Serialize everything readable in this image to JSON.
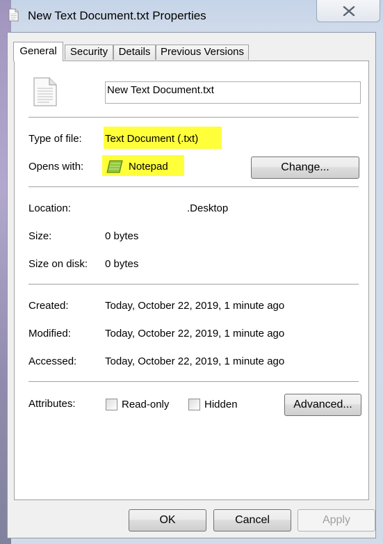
{
  "window": {
    "title": "New Text Document.txt Properties",
    "close_glyph": "✕"
  },
  "tabs": [
    {
      "label": "General",
      "active": true
    },
    {
      "label": "Security",
      "active": false
    },
    {
      "label": "Details",
      "active": false
    },
    {
      "label": "Previous Versions",
      "active": false
    }
  ],
  "general": {
    "file_name": "New Text Document.txt",
    "file_icon": "text-document-icon",
    "type_label": "Type of file:",
    "type_value": "Text Document (.txt)",
    "opens_label": "Opens with:",
    "opens_value": "Notepad",
    "opens_icon": "notepad-icon",
    "change_button": "Change...",
    "location_label": "Location:",
    "location_value": ".Desktop",
    "size_label": "Size:",
    "size_value": "0 bytes",
    "size_on_disk_label": "Size on disk:",
    "size_on_disk_value": "0 bytes",
    "created_label": "Created:",
    "created_value": "Today, October 22, 2019, 1 minute ago",
    "modified_label": "Modified:",
    "modified_value": "Today, October 22, 2019, 1 minute ago",
    "accessed_label": "Accessed:",
    "accessed_value": "Today, October 22, 2019, 1 minute ago",
    "attributes_label": "Attributes:",
    "readonly_label": "Read-only",
    "readonly_checked": false,
    "hidden_label": "Hidden",
    "hidden_checked": false,
    "advanced_button": "Advanced..."
  },
  "footer": {
    "ok": "OK",
    "cancel": "Cancel",
    "apply": "Apply",
    "apply_enabled": false
  },
  "colors": {
    "highlight": "#ffff3a",
    "panel_bg": "#ffffff",
    "dialog_bg": "#f0f0f0"
  }
}
